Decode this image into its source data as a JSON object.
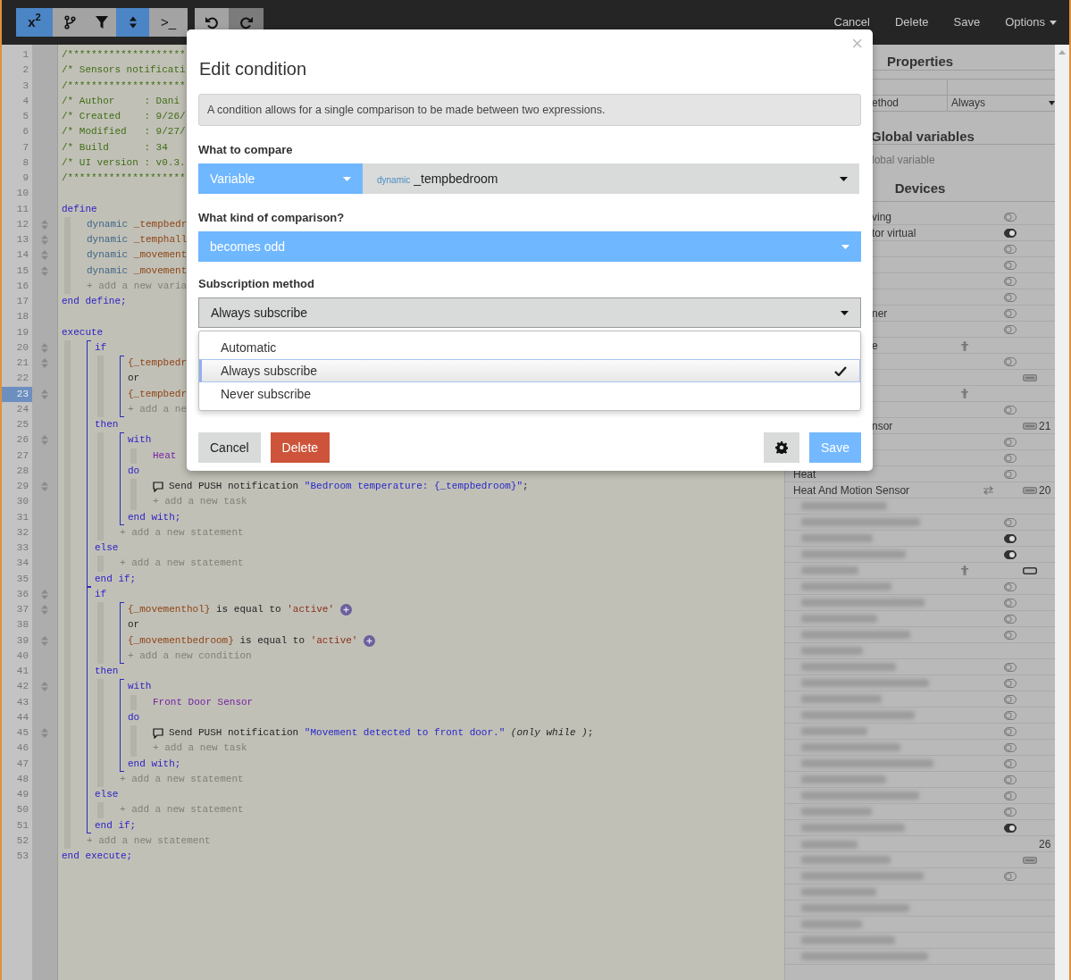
{
  "toolbar_groups": [
    {
      "buttons": [
        {
          "kind": "text",
          "label": "x$^{2}$",
          "active": true,
          "disabled": false
        },
        {
          "kind": "branch",
          "active": false,
          "disabled": false
        },
        {
          "kind": "filter",
          "active": false,
          "disabled": false
        },
        {
          "kind": "sort",
          "active": true,
          "disabled": false
        },
        {
          "kind": "text",
          "label": ">_",
          "active": false,
          "disabled": false
        }
      ]
    },
    {
      "buttons": [
        {
          "kind": "undo",
          "active": false,
          "disabled": false
        },
        {
          "kind": "redo",
          "active": false,
          "disabled": true
        }
      ]
    }
  ],
  "nav": [
    {
      "label": "Cancel",
      "dropdown": false
    },
    {
      "label": "Delete",
      "dropdown": false
    },
    {
      "label": "Save",
      "dropdown": false
    },
    {
      "label": "Options",
      "dropdown": true
    }
  ],
  "gutter": [
    {
      "number": "1",
      "fold": false,
      "selected": false
    },
    {
      "number": "2",
      "fold": false,
      "selected": false
    },
    {
      "number": "3",
      "fold": false,
      "selected": false
    },
    {
      "number": "4",
      "fold": false,
      "selected": false
    },
    {
      "number": "5",
      "fold": false,
      "selected": false
    },
    {
      "number": "6",
      "fold": false,
      "selected": false
    },
    {
      "number": "7",
      "fold": false,
      "selected": false
    },
    {
      "number": "8",
      "fold": false,
      "selected": false
    },
    {
      "number": "9",
      "fold": false,
      "selected": false
    },
    {
      "number": "10",
      "fold": false,
      "selected": false
    },
    {
      "number": "11",
      "fold": false,
      "selected": false
    },
    {
      "number": "12",
      "fold": true,
      "selected": false
    },
    {
      "number": "13",
      "fold": true,
      "selected": false
    },
    {
      "number": "14",
      "fold": true,
      "selected": false
    },
    {
      "number": "15",
      "fold": true,
      "selected": false
    },
    {
      "number": "16",
      "fold": false,
      "selected": false
    },
    {
      "number": "17",
      "fold": false,
      "selected": false
    },
    {
      "number": "18",
      "fold": false,
      "selected": false
    },
    {
      "number": "19",
      "fold": false,
      "selected": false
    },
    {
      "number": "20",
      "fold": true,
      "selected": false
    },
    {
      "number": "21",
      "fold": true,
      "selected": false
    },
    {
      "number": "22",
      "fold": false,
      "selected": false
    },
    {
      "number": "23",
      "fold": true,
      "selected": true
    },
    {
      "number": "24",
      "fold": false,
      "selected": false
    },
    {
      "number": "25",
      "fold": false,
      "selected": false
    },
    {
      "number": "26",
      "fold": true,
      "selected": false
    },
    {
      "number": "27",
      "fold": false,
      "selected": false
    },
    {
      "number": "28",
      "fold": false,
      "selected": false
    },
    {
      "number": "29",
      "fold": true,
      "selected": false
    },
    {
      "number": "30",
      "fold": false,
      "selected": false
    },
    {
      "number": "31",
      "fold": false,
      "selected": false
    },
    {
      "number": "32",
      "fold": false,
      "selected": false
    },
    {
      "number": "33",
      "fold": false,
      "selected": false
    },
    {
      "number": "34",
      "fold": false,
      "selected": false
    },
    {
      "number": "35",
      "fold": false,
      "selected": false
    },
    {
      "number": "36",
      "fold": true,
      "selected": false
    },
    {
      "number": "37",
      "fold": true,
      "selected": false
    },
    {
      "number": "38",
      "fold": false,
      "selected": false
    },
    {
      "number": "39",
      "fold": true,
      "selected": false
    },
    {
      "number": "40",
      "fold": false,
      "selected": false
    },
    {
      "number": "41",
      "fold": false,
      "selected": false
    },
    {
      "number": "42",
      "fold": true,
      "selected": false
    },
    {
      "number": "43",
      "fold": false,
      "selected": false
    },
    {
      "number": "44",
      "fold": false,
      "selected": false
    },
    {
      "number": "45",
      "fold": true,
      "selected": false
    },
    {
      "number": "46",
      "fold": false,
      "selected": false
    },
    {
      "number": "47",
      "fold": false,
      "selected": false
    },
    {
      "number": "48",
      "fold": false,
      "selected": false
    },
    {
      "number": "49",
      "fold": false,
      "selected": false
    },
    {
      "number": "50",
      "fold": false,
      "selected": false
    },
    {
      "number": "51",
      "fold": false,
      "selected": false
    },
    {
      "number": "52",
      "fold": false,
      "selected": false
    },
    {
      "number": "53",
      "fold": false,
      "selected": false
    }
  ],
  "code": [
    {
      "kind": "line",
      "segments": [
        {
          "kind": "comment",
          "text": "/********************"
        }
      ]
    },
    {
      "kind": "line",
      "segments": [
        {
          "kind": "comment",
          "text": "/* Sensors notificati"
        }
      ]
    },
    {
      "kind": "line",
      "segments": [
        {
          "kind": "comment",
          "text": "/********************"
        }
      ]
    },
    {
      "kind": "line",
      "segments": [
        {
          "kind": "comment",
          "text": "/* Author     : Dani"
        }
      ]
    },
    {
      "kind": "line",
      "segments": [
        {
          "kind": "comment",
          "text": "/* Created    : 9/26/"
        }
      ]
    },
    {
      "kind": "line",
      "segments": [
        {
          "kind": "comment",
          "text": "/* Modified   : 9/27/"
        }
      ]
    },
    {
      "kind": "line",
      "segments": [
        {
          "kind": "comment",
          "text": "/* Build      : 34"
        }
      ]
    },
    {
      "kind": "line",
      "segments": [
        {
          "kind": "comment",
          "text": "/* UI version : v0.3."
        }
      ]
    },
    {
      "kind": "line",
      "segments": [
        {
          "kind": "comment",
          "text": "/********************"
        }
      ]
    },
    {
      "kind": "line"
    },
    {
      "kind": "line",
      "segments": [
        {
          "kind": "keyword",
          "text": "define"
        }
      ]
    },
    {
      "kind": "indent",
      "children": [
        {
          "kind": "line",
          "segments": [
            {
              "kind": "datatype",
              "text": "dynamic"
            },
            {
              "kind": "variable",
              "text": " _tempbedr"
            }
          ]
        },
        {
          "kind": "line",
          "segments": [
            {
              "kind": "datatype",
              "text": "dynamic"
            },
            {
              "kind": "variable",
              "text": " _temphall"
            }
          ]
        },
        {
          "kind": "line",
          "segments": [
            {
              "kind": "datatype",
              "text": "dynamic"
            },
            {
              "kind": "variable",
              "text": " _movement"
            }
          ]
        },
        {
          "kind": "line",
          "segments": [
            {
              "kind": "datatype",
              "text": "dynamic"
            },
            {
              "kind": "variable",
              "text": " _movement"
            }
          ]
        },
        {
          "kind": "line",
          "segments": [
            {
              "kind": "hint",
              "text": "+ add a new varia"
            }
          ]
        }
      ]
    },
    {
      "kind": "line",
      "segments": [
        {
          "kind": "keyword",
          "text": "end define;"
        }
      ]
    },
    {
      "kind": "line"
    },
    {
      "kind": "line",
      "segments": [
        {
          "kind": "keyword",
          "text": "execute"
        }
      ]
    },
    {
      "kind": "indent",
      "children": [
        {
          "kind": "bracket",
          "children": [
            {
              "kind": "line",
              "segments": [
                {
                  "kind": "keyword",
                  "text": "if"
                }
              ]
            },
            {
              "kind": "indent",
              "children": [
                {
                  "kind": "bracket",
                  "children": [
                    {
                      "kind": "line",
                      "segments": [
                        {
                          "kind": "variable",
                          "text": "{_tempbedr"
                        }
                      ]
                    },
                    {
                      "kind": "line",
                      "segments": [
                        {
                          "kind": "plain",
                          "text": "or"
                        }
                      ]
                    },
                    {
                      "kind": "line",
                      "segments": [
                        {
                          "kind": "variable",
                          "text": "{_tempbedr"
                        }
                      ]
                    },
                    {
                      "kind": "line",
                      "segments": [
                        {
                          "kind": "hint",
                          "text": "+ add a ne"
                        }
                      ]
                    }
                  ]
                }
              ]
            },
            {
              "kind": "line",
              "segments": [
                {
                  "kind": "keyword",
                  "text": "then"
                }
              ]
            },
            {
              "kind": "indent",
              "children": [
                {
                  "kind": "bracket",
                  "children": [
                    {
                      "kind": "line",
                      "segments": [
                        {
                          "kind": "keyword",
                          "text": "with"
                        }
                      ]
                    },
                    {
                      "kind": "indent",
                      "children": [
                        {
                          "kind": "line",
                          "segments": [
                            {
                              "kind": "device",
                              "text": "Heat"
                            }
                          ]
                        }
                      ]
                    },
                    {
                      "kind": "line",
                      "segments": [
                        {
                          "kind": "keyword",
                          "text": "do"
                        }
                      ]
                    },
                    {
                      "kind": "indent",
                      "children": [
                        {
                          "kind": "line",
                          "speech": true,
                          "segments": [
                            {
                              "kind": "plain",
                              "text": "Send PUSH notification "
                            },
                            {
                              "kind": "string",
                              "text": "\"Bedroom temperature: {_tempbedroom}\""
                            },
                            {
                              "kind": "plain",
                              "text": ";"
                            }
                          ]
                        },
                        {
                          "kind": "line",
                          "segments": [
                            {
                              "kind": "hint",
                              "text": "+ add a new task"
                            }
                          ]
                        }
                      ]
                    },
                    {
                      "kind": "line",
                      "segments": [
                        {
                          "kind": "keyword",
                          "text": "end with;"
                        }
                      ]
                    }
                  ]
                },
                {
                  "kind": "line",
                  "segments": [
                    {
                      "kind": "hint",
                      "text": "+ add a new statement"
                    }
                  ]
                }
              ]
            },
            {
              "kind": "line",
              "segments": [
                {
                  "kind": "keyword",
                  "text": "else"
                }
              ]
            },
            {
              "kind": "indent",
              "children": [
                {
                  "kind": "line",
                  "segments": [
                    {
                      "kind": "hint",
                      "text": "+ add a new statement"
                    }
                  ]
                }
              ]
            },
            {
              "kind": "line",
              "segments": [
                {
                  "kind": "keyword",
                  "text": "end if;"
                }
              ]
            }
          ]
        },
        {
          "kind": "bracket",
          "children": [
            {
              "kind": "line",
              "segments": [
                {
                  "kind": "keyword",
                  "text": "if"
                }
              ]
            },
            {
              "kind": "indent",
              "children": [
                {
                  "kind": "bracket",
                  "children": [
                    {
                      "kind": "line",
                      "plus": true,
                      "segments": [
                        {
                          "kind": "variable",
                          "text": "{_movementhol}"
                        },
                        {
                          "kind": "plain",
                          "text": " is equal to "
                        },
                        {
                          "kind": "literal",
                          "text": "'active'"
                        }
                      ]
                    },
                    {
                      "kind": "line",
                      "segments": [
                        {
                          "kind": "plain",
                          "text": "or"
                        }
                      ]
                    },
                    {
                      "kind": "line",
                      "plus": true,
                      "segments": [
                        {
                          "kind": "variable",
                          "text": "{_movementbedroom}"
                        },
                        {
                          "kind": "plain",
                          "text": " is equal to "
                        },
                        {
                          "kind": "literal",
                          "text": "'active'"
                        }
                      ]
                    },
                    {
                      "kind": "line",
                      "segments": [
                        {
                          "kind": "hint",
                          "text": "+ add a new condition"
                        }
                      ]
                    }
                  ]
                }
              ]
            },
            {
              "kind": "line",
              "segments": [
                {
                  "kind": "keyword",
                  "text": "then"
                }
              ]
            },
            {
              "kind": "indent",
              "children": [
                {
                  "kind": "bracket",
                  "children": [
                    {
                      "kind": "line",
                      "segments": [
                        {
                          "kind": "keyword",
                          "text": "with"
                        }
                      ]
                    },
                    {
                      "kind": "indent",
                      "children": [
                        {
                          "kind": "line",
                          "segments": [
                            {
                              "kind": "device",
                              "text": "Front Door Sensor"
                            }
                          ]
                        }
                      ]
                    },
                    {
                      "kind": "line",
                      "segments": [
                        {
                          "kind": "keyword",
                          "text": "do"
                        }
                      ]
                    },
                    {
                      "kind": "indent",
                      "children": [
                        {
                          "kind": "line",
                          "speech": true,
                          "segments": [
                            {
                              "kind": "plain",
                              "text": "Send PUSH notification "
                            },
                            {
                              "kind": "string",
                              "text": "\"Movement detected to front door.\""
                            },
                            {
                              "kind": "italic",
                              "text": " (only while )"
                            },
                            {
                              "kind": "plain",
                              "text": ";"
                            }
                          ]
                        },
                        {
                          "kind": "line",
                          "segments": [
                            {
                              "kind": "hint",
                              "text": "+ add a new task"
                            }
                          ]
                        }
                      ]
                    },
                    {
                      "kind": "line",
                      "segments": [
                        {
                          "kind": "keyword",
                          "text": "end with;"
                        }
                      ]
                    }
                  ]
                },
                {
                  "kind": "line",
                  "segments": [
                    {
                      "kind": "hint",
                      "text": "+ add a new statement"
                    }
                  ]
                }
              ]
            },
            {
              "kind": "line",
              "segments": [
                {
                  "kind": "keyword",
                  "text": "else"
                }
              ]
            },
            {
              "kind": "indent",
              "children": [
                {
                  "kind": "line",
                  "segments": [
                    {
                      "kind": "hint",
                      "text": "+ add a new statement"
                    }
                  ]
                }
              ]
            },
            {
              "kind": "line",
              "segments": [
                {
                  "kind": "keyword",
                  "text": "end if;"
                }
              ]
            }
          ]
        },
        {
          "kind": "line",
          "segments": [
            {
              "kind": "hint",
              "text": "+ add a new statement"
            }
          ]
        }
      ]
    },
    {
      "kind": "line",
      "segments": [
        {
          "kind": "keyword",
          "text": "end execute;"
        }
      ]
    }
  ],
  "properties": {
    "title": "Properties",
    "rows": [
      {},
      {
        "label": "ethod",
        "value": "Always",
        "dropdown": true
      }
    ]
  },
  "global_variables": {
    "title": "Global variables",
    "placeholder": "lobal variable"
  },
  "devices": {
    "title": "Devices",
    "items": [
      {
        "name": "ving",
        "switch_on": false
      },
      {
        "name": "tor virtual",
        "switch_on": true
      },
      {
        "switch_on": false
      },
      {
        "switch_on": false
      },
      {
        "switch_on": false
      },
      {
        "switch_on": false
      },
      {
        "name": "ner",
        "switch_on": false
      },
      {
        "switch_on": false
      },
      {
        "name": "e",
        "person": true
      },
      {
        "switch_on": false
      },
      {
        "battery_full": true
      },
      {
        "person": true
      },
      {
        "switch_on": false
      },
      {
        "name": "nsor",
        "battery_full": true,
        "reading": "21"
      },
      {
        "switch_on": false
      },
      {
        "switch_on": false
      },
      {
        "name": "Heat",
        "switch_on": false
      },
      {
        "name": "Heat And Motion Sensor",
        "swap": true,
        "battery_full": true,
        "reading": "20"
      },
      {
        "blurred": true
      },
      {
        "blurred": true,
        "switch_on": false
      },
      {
        "blurred": true,
        "switch_on": true
      },
      {
        "blurred": true,
        "switch_on": true
      },
      {
        "blurred": true,
        "person": true,
        "battery_full": false
      },
      {
        "blurred": true,
        "switch_on": false
      },
      {
        "blurred": true,
        "switch_on": false
      },
      {
        "blurred": true,
        "switch_on": false
      },
      {
        "blurred": true,
        "switch_on": false
      },
      {
        "blurred": true
      },
      {
        "blurred": true,
        "switch_on": false
      },
      {
        "blurred": true,
        "switch_on": false
      },
      {
        "blurred": true,
        "switch_on": false
      },
      {
        "blurred": true,
        "switch_on": false
      },
      {
        "blurred": true,
        "switch_on": false
      },
      {
        "blurred": true,
        "switch_on": false
      },
      {
        "blurred": true,
        "switch_on": false
      },
      {
        "blurred": true,
        "switch_on": false
      },
      {
        "blurred": true,
        "switch_on": false
      },
      {
        "blurred": true,
        "switch_on": false
      },
      {
        "blurred": true,
        "switch_on": true
      },
      {
        "blurred": true,
        "reading": "26"
      },
      {
        "blurred": true,
        "battery_full": true
      },
      {
        "blurred": true,
        "switch_on": false
      },
      {
        "blurred": true
      },
      {
        "blurred": true
      },
      {
        "blurred": true
      },
      {
        "blurred": true
      },
      {
        "blurred": true
      }
    ]
  },
  "modal": {
    "close": "×",
    "title": "Edit condition",
    "info": "A condition allows for a single comparison to be made between two expressions.",
    "compare": {
      "label": "What to compare",
      "type": "Variable",
      "value_prefix": "dynamic",
      "value": "_tempbedroom"
    },
    "comparison": {
      "label": "What kind of comparison?",
      "value": "becomes odd"
    },
    "subscription": {
      "label": "Subscription method",
      "value": "Always subscribe",
      "expanded": true,
      "options": [
        {
          "label": "Automatic",
          "selected": false
        },
        {
          "label": "Always subscribe",
          "selected": true
        },
        {
          "label": "Never subscribe",
          "selected": false
        }
      ]
    },
    "buttons": [
      {
        "kind": "cancel",
        "label": "Cancel"
      },
      {
        "kind": "delete",
        "label": "Delete"
      },
      {
        "kind": "settings"
      },
      {
        "kind": "save",
        "label": "Save"
      }
    ]
  }
}
